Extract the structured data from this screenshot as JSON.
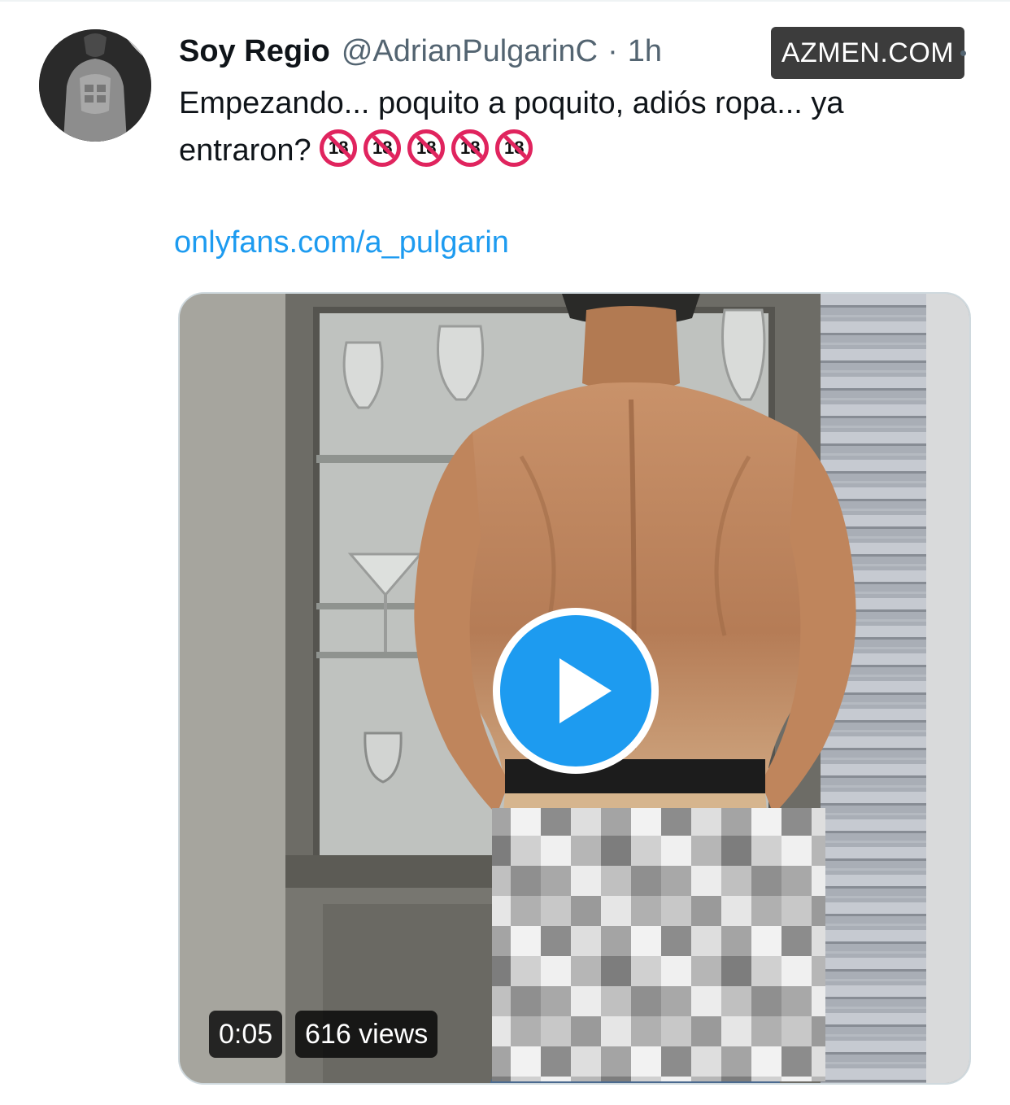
{
  "tweet": {
    "author": {
      "display_name": "Soy Regio",
      "handle": "@AdrianPulgarinC",
      "separator": "·",
      "timestamp": "1h",
      "avatar_icon": "avatar-photo"
    },
    "watermark": "AZMEN.COM",
    "text_line": "Empezando... poquito a poquito, adiós ropa... ya entraron?",
    "emoji": [
      "18",
      "18",
      "18",
      "18",
      "18"
    ],
    "link": "onlyfans.com/a_pulgarin",
    "video": {
      "duration": "0:05",
      "views": "616 views",
      "play_icon": "play-icon"
    }
  },
  "colors": {
    "link": "#1d9bf0",
    "play_button": "#1d9bf0",
    "secondary_text": "#536471",
    "emoji_ring": "#e0245e"
  }
}
